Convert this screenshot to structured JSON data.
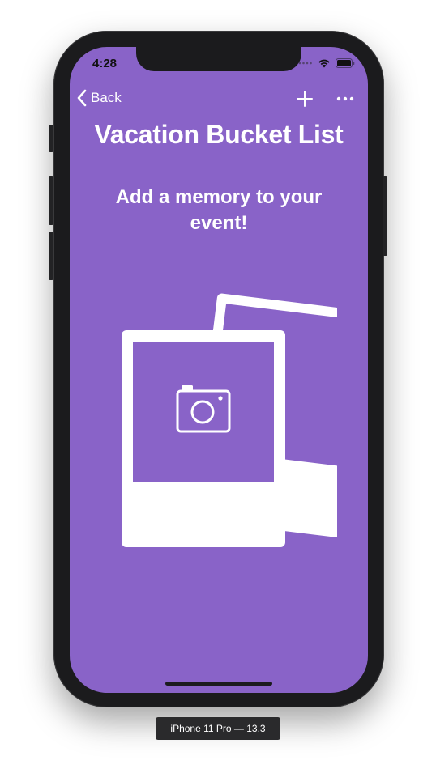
{
  "status_bar": {
    "time": "4:28",
    "icons": [
      "signal-dots-icon",
      "wifi-icon",
      "battery-icon"
    ]
  },
  "nav": {
    "back_label": "Back",
    "back_icon": "chevron-left-icon",
    "add_icon": "plus-icon",
    "more_icon": "ellipsis-icon"
  },
  "page": {
    "title": "Vacation Bucket List",
    "empty_message": "Add a memory to your event!",
    "illustration_icon": "photos-camera-icon"
  },
  "device_label": "iPhone 11 Pro — 13.3",
  "colors": {
    "background": "#8963c8",
    "foreground": "#ffffff",
    "phone_frame": "#1b1b1d"
  }
}
